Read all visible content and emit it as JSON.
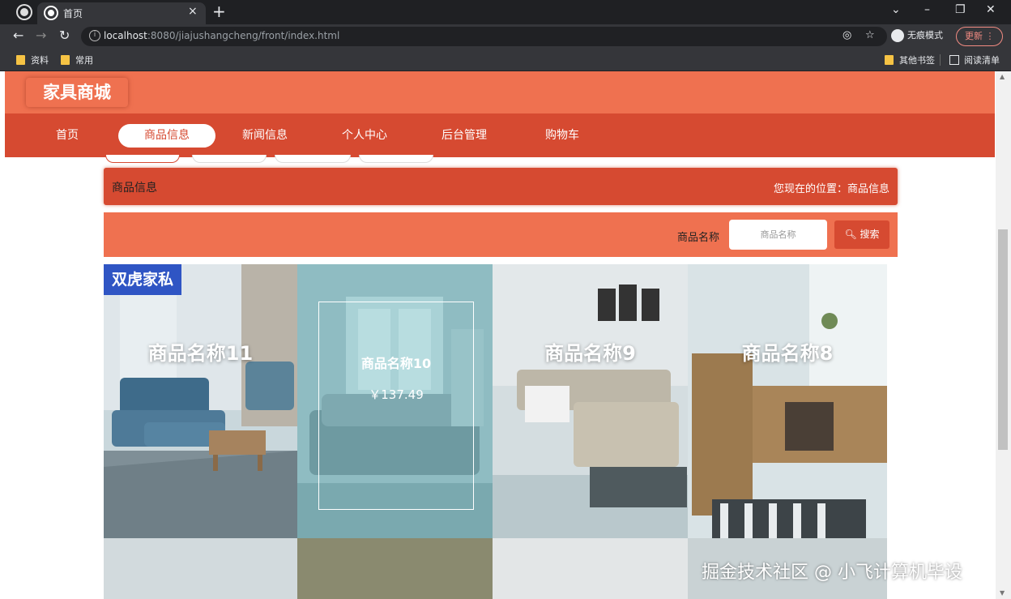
{
  "browser": {
    "tab_title": "首页",
    "tab_close": "×",
    "new_tab": "+",
    "url_host": "localhost",
    "url_rest": ":8080/jiajushangcheng/front/index.html",
    "incognito_label": "无痕模式",
    "update_label": "更新",
    "bookmarks": [
      "资料",
      "常用"
    ],
    "other_bookmarks": "其他书签",
    "reading_list": "阅读清单"
  },
  "site": {
    "logo": "家具商城",
    "nav": [
      "首页",
      "商品信息",
      "新闻信息",
      "个人中心",
      "后台管理",
      "购物车"
    ],
    "active_nav": "商品信息",
    "breadcrumb_title": "商品信息",
    "location": "您现在的位置：商品信息",
    "search_label": "商品名称",
    "search_placeholder": "商品名称",
    "search_button": "搜索"
  },
  "products": [
    {
      "name": "商品名称11",
      "brand_tag": "双虎家私"
    },
    {
      "name": "商品名称10",
      "price": "￥137.49"
    },
    {
      "name": "商品名称9"
    },
    {
      "name": "商品名称8"
    }
  ],
  "watermark": "掘金技术社区 @ 小飞计算机毕设",
  "colors": {
    "header": "#ef7150",
    "nav": "#d64a31",
    "brand_tag": "#2f55c4",
    "browser_dark": "#35363a"
  },
  "icons": [
    "globe-icon",
    "back-icon",
    "forward-icon",
    "reload-icon",
    "info-icon",
    "star-icon",
    "search-icon",
    "folder-icon"
  ]
}
